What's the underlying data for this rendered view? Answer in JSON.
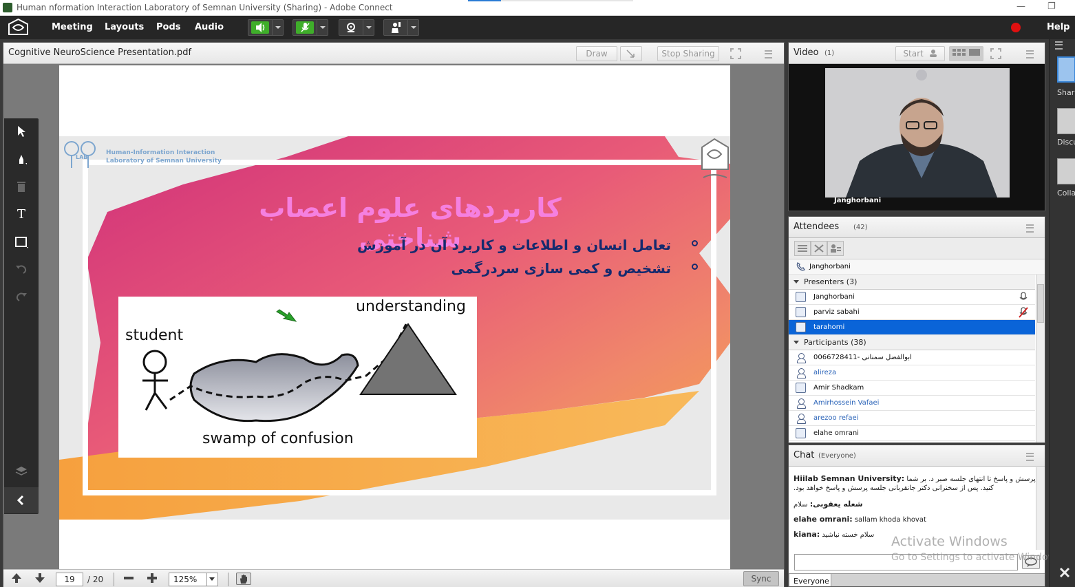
{
  "window": {
    "title": "Human nformation Interaction Laboratory of Semnan University (Sharing) - Adobe Connect",
    "minimize": "—",
    "maximize": "❐"
  },
  "menubar": {
    "items": [
      "Meeting",
      "Layouts",
      "Pods",
      "Audio"
    ],
    "help": "Help",
    "colors": {
      "speaker_green": "#3fae2a",
      "record_red": "#e01010"
    }
  },
  "share_pod": {
    "title": "Cognitive NeuroScience Presentation.pdf",
    "draw_label": "Draw",
    "stop_sharing_label": "Stop Sharing",
    "page_current": "19",
    "page_total": "/ 20",
    "zoom": "125%",
    "sync_label": "Sync",
    "slide": {
      "lab_line1": "Human-Information Interaction",
      "lab_line2": "Laboratory of Semnan University",
      "lab_mark": "LAB",
      "title": "کاربردهای علوم اعصاب شناختی",
      "bullets": [
        "تعامل انسان و اطلاعات و کاربرد آن در آموزش",
        "تشخیص و کمی سازی سردرگمی"
      ],
      "figure": {
        "student": "student",
        "understanding": "understanding",
        "swamp": "swamp of confusion"
      }
    }
  },
  "video_pod": {
    "title": "Video",
    "count": "(1)",
    "start_label": "Start",
    "participant": "Janghorbani"
  },
  "attendees_pod": {
    "title": "Attendees",
    "count": "(42)",
    "host": "Janghorbani",
    "presenters_group": "Presenters (3)",
    "presenters": [
      "Janghorbani",
      "parviz sabahi",
      "tarahomi"
    ],
    "participants_group": "Participants (38)",
    "participants": [
      "0066728411- ابوالفضل سمنانی",
      "alireza",
      "Amir Shadkam",
      "Amirhossein Vafaei",
      "arezoo refaei",
      "elahe omrani"
    ]
  },
  "chat_pod": {
    "title": "Chat",
    "scope": "(Everyone)",
    "messages": [
      {
        "sender": "Hiilab Semnan University:",
        "text": "لطفا برای پرسش و پاسخ تا انتهای جلسه صبر",
        "suffix": "د. بر شما،"
      },
      {
        "sender": "",
        "text": ".کنید. پس از سخنرانی دکتر جانقربانی جلسه پرسش و پاسخ خواهد بود"
      },
      {
        "sender": "شعله یعقوبی:",
        "text": "سلام"
      },
      {
        "sender": "elahe omrani:",
        "text": "sallam khoda khovat"
      },
      {
        "sender": "kiana:",
        "text": "سلام خسته نباشید"
      }
    ],
    "tab": "Everyone"
  },
  "watermark": {
    "line1": "Activate Windows",
    "line2": "Go to Settings to activate Windows."
  },
  "layouts": [
    {
      "label": "Shari"
    },
    {
      "label": "Discu"
    },
    {
      "label": "Colla"
    }
  ]
}
